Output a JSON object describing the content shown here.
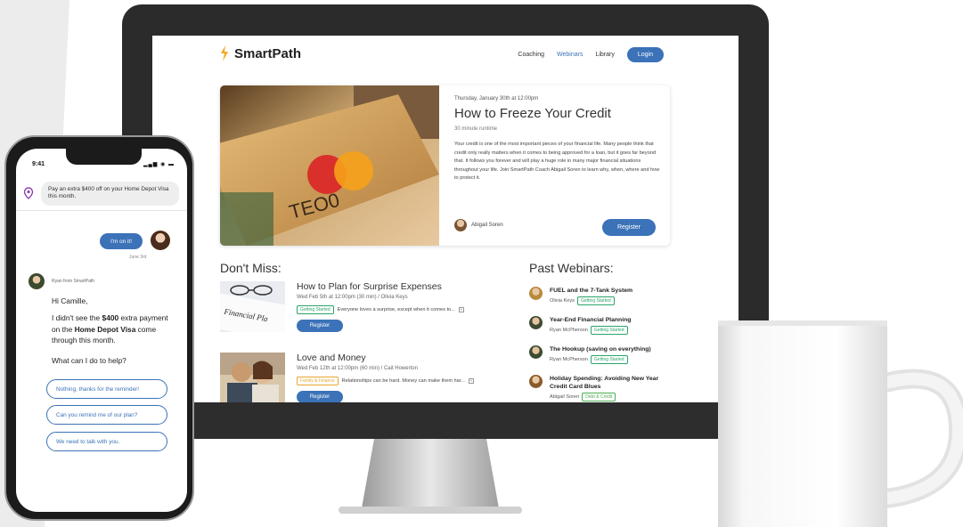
{
  "site": {
    "brand": "SmartPath",
    "nav": [
      "Coaching",
      "Webinars",
      "Library"
    ],
    "nav_active": "Webinars",
    "login": "Login",
    "accent": "#3b72b8"
  },
  "featured": {
    "card_text": "TEO0",
    "date": "Thursday, January 30th at 12:00pm",
    "title": "How to Freeze Your Credit",
    "runtime": "30 minute runtime",
    "description": "Your credit is one of the most important pieces of your financial life. Many people think that credit only really matters when it comes to being approved for a loan, but it goes far beyond that. It follows you forever and will play a huge role in many major financial situations throughout your life. Join SmartPath Coach Abigail Soren to learn why, when, where and how to protect it.",
    "host": "Abigail Soren",
    "register": "Register"
  },
  "dont_miss": {
    "heading": "Don't Miss:",
    "items": [
      {
        "title": "How to Plan for Surprise Expenses",
        "meta": "Wed Feb 5th at 12:00pm (30 min)  /  Olivia Keys",
        "tag": "Getting Started",
        "tag_color": "#2aa56b",
        "excerpt": "Everyone loves a surprise, except when it comes to...",
        "button": "Register",
        "thumb_text": "Financial Pla"
      },
      {
        "title": "Love and Money",
        "meta": "Wed Feb 12th at 12:00pm (60 min)  /  Cait Howerton",
        "tag": "Family & Finance",
        "tag_color": "#e9a531",
        "excerpt": "Relationships can be hard. Money can make them har...",
        "button": "Register"
      }
    ]
  },
  "past_webinars": {
    "heading": "Past Webinars:",
    "items": [
      {
        "title": "FUEL and the 7-Tank System",
        "host": "Olivia Keys",
        "tag": "Getting Started"
      },
      {
        "title": "Year-End Financial Planning",
        "host": "Ryan McPherson",
        "tag": "Getting Started"
      },
      {
        "title": "The Hookup (saving on everything)",
        "host": "Ryan McPherson",
        "tag": "Getting Started"
      },
      {
        "title": "Holiday Spending: Avoiding New Year Credit Card Blues",
        "host": "Abigail Soren",
        "tag": "Debt & Credit"
      }
    ]
  },
  "phone": {
    "time": "9:41",
    "alert": "Pay an extra $400 off on your Home Depot Visa this month.",
    "reply": "I'm on it!",
    "date": "June 3rd",
    "coach": "Ryan from SmartPath",
    "greeting": "Hi Camille,",
    "message_prefix": "I didn't see the ",
    "amount": "$400",
    "message_mid": " extra payment on the ",
    "card": "Home Depot Visa",
    "message_suffix": " come through this month.",
    "question": "What can I do to help?",
    "options": [
      "Nothing, thanks for the reminder!",
      "Can you remind me of our plan?",
      "We need to talk with you."
    ]
  }
}
